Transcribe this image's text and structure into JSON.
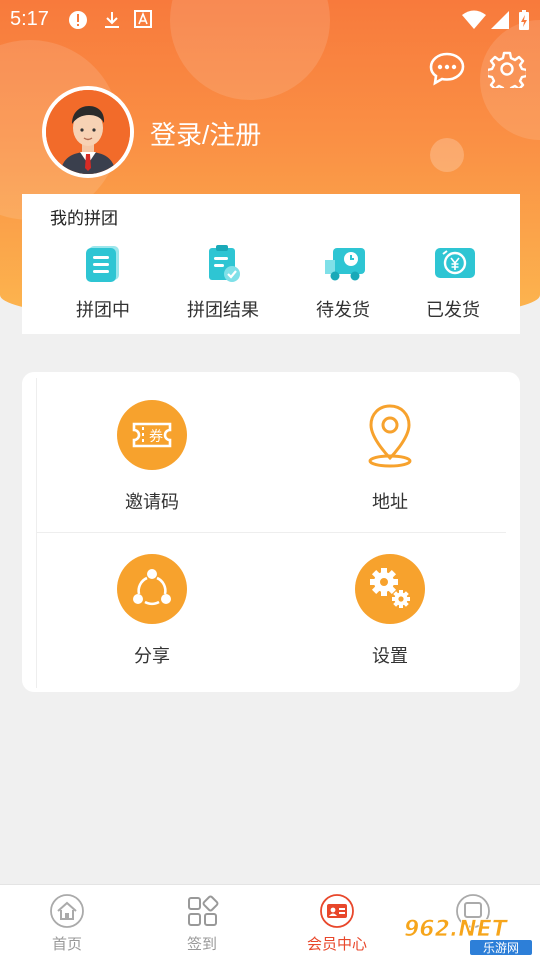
{
  "status_bar": {
    "time": "5:17"
  },
  "profile": {
    "login_label": "登录/注册"
  },
  "my_group": {
    "title": "我的拼团",
    "items": [
      {
        "label": "拼团中",
        "icon": "document-list-icon"
      },
      {
        "label": "拼团结果",
        "icon": "clipboard-check-icon"
      },
      {
        "label": "待发货",
        "icon": "delivery-truck-icon"
      },
      {
        "label": "已发货",
        "icon": "shipped-yen-icon"
      }
    ]
  },
  "functions": {
    "items": [
      {
        "label": "邀请码",
        "icon": "coupon-icon",
        "icon_text": "券"
      },
      {
        "label": "地址",
        "icon": "location-pin-icon"
      },
      {
        "label": "分享",
        "icon": "share-icon"
      },
      {
        "label": "设置",
        "icon": "gears-icon"
      }
    ]
  },
  "bottom_nav": {
    "items": [
      {
        "label": "首页",
        "icon": "home-icon"
      },
      {
        "label": "签到",
        "icon": "grid-icon"
      },
      {
        "label": "会员中心",
        "icon": "member-card-icon",
        "active": true
      },
      {
        "label": "",
        "icon": "partial-icon"
      }
    ]
  },
  "watermark": {
    "text": "962.NET",
    "subtext": "乐游网"
  },
  "colors": {
    "header_top": "#f87a3c",
    "header_bottom": "#fcb74f",
    "accent_orange": "#f7a22d",
    "teal": "#2ec5d3",
    "active_red": "#e8472b"
  }
}
